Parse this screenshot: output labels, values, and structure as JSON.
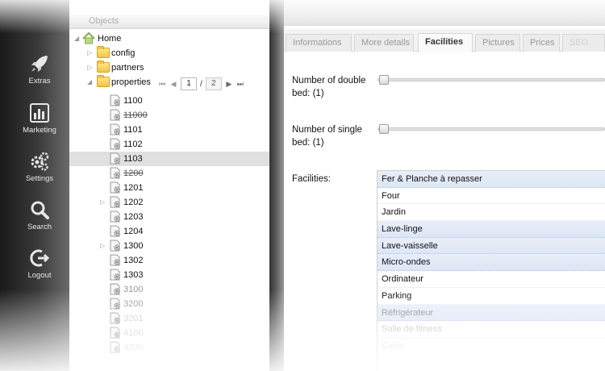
{
  "nav": {
    "items": [
      {
        "label": "Extras",
        "icon": "rocket-icon"
      },
      {
        "label": "Marketing",
        "icon": "chart-icon"
      },
      {
        "label": "Settings",
        "icon": "gears-icon"
      },
      {
        "label": "Search",
        "icon": "magnifier-icon"
      },
      {
        "label": "Logout",
        "icon": "logout-icon"
      }
    ]
  },
  "tree": {
    "header": "Objects",
    "home": "Home",
    "folders": [
      "config",
      "partners",
      "properties"
    ],
    "pager": {
      "current": "1",
      "separator": "/",
      "total": "2"
    },
    "items": [
      {
        "name": "1100",
        "strike": false,
        "expandable": false
      },
      {
        "name": "11000",
        "strike": true,
        "expandable": false
      },
      {
        "name": "1101",
        "strike": false,
        "expandable": false
      },
      {
        "name": "1102",
        "strike": false,
        "expandable": false
      },
      {
        "name": "1103",
        "strike": false,
        "expandable": false,
        "selected": true
      },
      {
        "name": "1200",
        "strike": true,
        "expandable": false
      },
      {
        "name": "1201",
        "strike": false,
        "expandable": false
      },
      {
        "name": "1202",
        "strike": false,
        "expandable": true
      },
      {
        "name": "1203",
        "strike": false,
        "expandable": false
      },
      {
        "name": "1204",
        "strike": false,
        "expandable": false
      },
      {
        "name": "1300",
        "strike": false,
        "expandable": true
      },
      {
        "name": "1302",
        "strike": false,
        "expandable": false
      },
      {
        "name": "1303",
        "strike": false,
        "expandable": false
      },
      {
        "name": "3100",
        "strike": false,
        "expandable": false
      },
      {
        "name": "3200",
        "strike": false,
        "expandable": false
      },
      {
        "name": "3201",
        "strike": false,
        "expandable": false
      },
      {
        "name": "4100",
        "strike": false,
        "expandable": false
      },
      {
        "name": "4200",
        "strike": false,
        "expandable": false
      }
    ]
  },
  "tabs": [
    "Informations",
    "More details",
    "Facilities",
    "Pictures",
    "Prices",
    "SEO"
  ],
  "active_tab": "Facilities",
  "form": {
    "double_bed_label": "Number of double bed: (1)",
    "double_bed_value": 1,
    "single_bed_label": "Number of single bed: (1)",
    "single_bed_value": 1,
    "facilities_label": "Facilities:",
    "facilities": [
      {
        "label": "Fer & Planche à repasser",
        "selected": true
      },
      {
        "label": "Four",
        "selected": false
      },
      {
        "label": "Jardin",
        "selected": false
      },
      {
        "label": "Lave-linge",
        "selected": true
      },
      {
        "label": "Lave-vaisselle",
        "selected": true
      },
      {
        "label": "Micro-ondes",
        "selected": true
      },
      {
        "label": "Ordinateur",
        "selected": false
      },
      {
        "label": "Parking",
        "selected": false
      },
      {
        "label": "Réfrigérateur",
        "selected": true
      },
      {
        "label": "Salle de fitness",
        "selected": false
      },
      {
        "label": "Cable",
        "selected": false
      }
    ]
  }
}
